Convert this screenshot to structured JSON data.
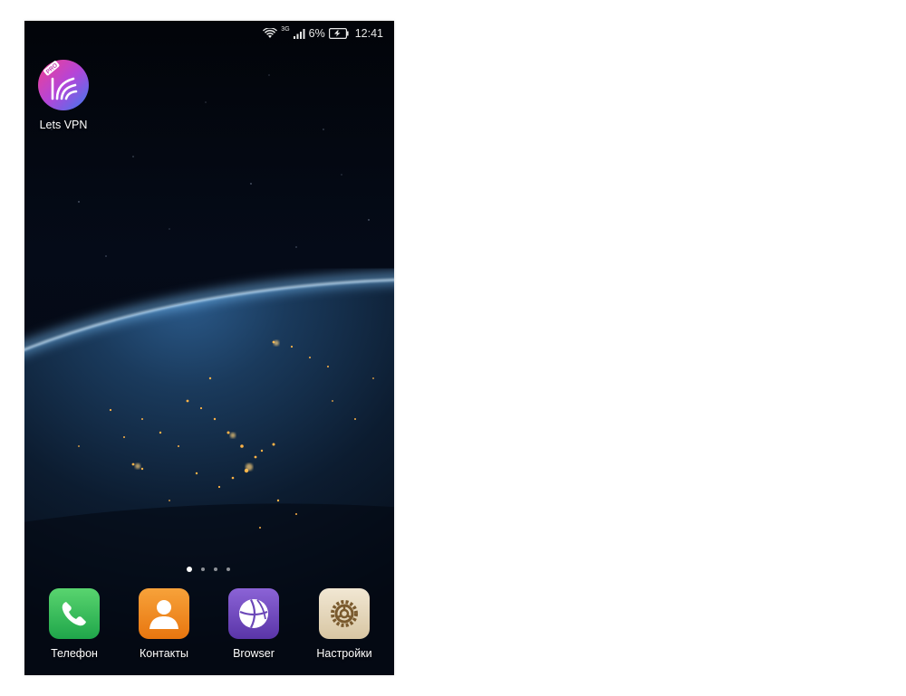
{
  "status_bar": {
    "network": "3G",
    "battery_percent": "6%",
    "time": "12:41"
  },
  "home_apps": [
    {
      "label": "Lets VPN",
      "icon": "lets-vpn-icon",
      "badge": "PRO"
    }
  ],
  "page_indicator": {
    "count": 4,
    "active_index": 0
  },
  "dock": [
    {
      "label": "Телефон",
      "icon": "phone-icon"
    },
    {
      "label": "Контакты",
      "icon": "contacts-icon"
    },
    {
      "label": "Browser",
      "icon": "browser-icon"
    },
    {
      "label": "Настройки",
      "icon": "settings-icon"
    }
  ],
  "colors": {
    "phone_green": "#3cc15a",
    "contacts_orange": "#f08a1c",
    "browser_purple": "#6b47b8",
    "settings_beige": "#e8dcc6",
    "vpn_gradient_start": "#e03fae",
    "vpn_gradient_end": "#3b7bf0"
  }
}
